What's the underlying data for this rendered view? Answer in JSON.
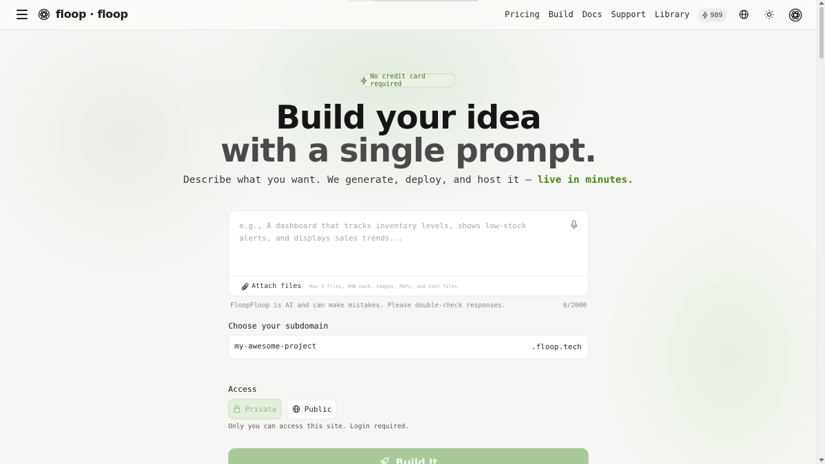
{
  "header": {
    "brand": "floop · floop",
    "nav": [
      "Pricing",
      "Build",
      "Docs",
      "Support",
      "Library"
    ],
    "credits": "989"
  },
  "hero": {
    "badge": "No credit card required",
    "title_line1": "Build your idea",
    "title_line2": "with a single prompt.",
    "subtitle_main": "Describe what you want. We generate, deploy, and host it — ",
    "subtitle_highlight": "live in minutes."
  },
  "prompt": {
    "placeholder": "e.g., A dashboard that tracks inventory levels, shows low-stock alerts, and displays sales trends...",
    "value": "",
    "attach_label": "Attach files",
    "attach_hint": "Max 5 files, 5MB each. Images, PDFs, and text files.",
    "disclaimer": "FloopFloop is AI and can make mistakes. Please double-check responses.",
    "counter": "0/2000"
  },
  "subdomain": {
    "label": "Choose your subdomain",
    "value": "my-awesome-project",
    "suffix": ".floop.tech"
  },
  "access": {
    "label": "Access",
    "private_label": "Private",
    "public_label": "Public",
    "hint": "Only you can access this site. Login required.",
    "selected": "Private"
  },
  "build_button": "Build It",
  "colors": {
    "accent_green": "#4c8a1c",
    "build_button": "#a9c99b",
    "private_selected_bg": "#e4efde",
    "progress_accent": "#4fb3bf"
  }
}
